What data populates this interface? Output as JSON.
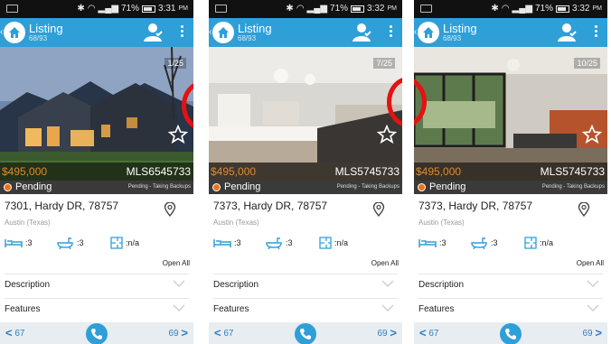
{
  "statusbar": {
    "screens": [
      {
        "battery": "71%",
        "time": "3:31",
        "ampm": "PM"
      },
      {
        "battery": "71%",
        "time": "3:32",
        "ampm": "PM"
      },
      {
        "battery": "71%",
        "time": "3:32",
        "ampm": "PM"
      }
    ]
  },
  "appbar": {
    "title": "Listing",
    "subtitle": "68/93"
  },
  "screens": [
    {
      "photo_counter": "1/25",
      "price": "$495,000",
      "mls": "MLS6545733"
    },
    {
      "photo_counter": "7/25",
      "price": "$495,000",
      "mls": "MLS5745733"
    },
    {
      "photo_counter": "10/25",
      "price": "$495,000",
      "mls": "MLS5745733"
    }
  ],
  "listing": {
    "status": "Pending",
    "status_detail": "Pending - Taking Backups",
    "address": "7373, Hardy DR, 78757",
    "address_first": "7301, Hardy DR, 78757",
    "city": "Austin (Texas)",
    "beds": ":3",
    "baths": ":3",
    "area": ":n/a"
  },
  "sections": {
    "open_all": "Open All",
    "description": "Description",
    "features": "Features"
  },
  "nav": {
    "prev": "67",
    "next": "69"
  },
  "colors": {
    "accent": "#2f9fd8",
    "price": "#e08a2b",
    "pending_dot": "#e8731b",
    "highlight_circle": "#e41212"
  },
  "icons": [
    "home-icon",
    "agent-icon",
    "overflow-menu-icon",
    "star-icon",
    "location-pin-icon",
    "bed-icon",
    "bath-icon",
    "floorplan-icon",
    "chevron-down-icon",
    "phone-icon",
    "chevron-left-icon",
    "chevron-right-icon"
  ]
}
